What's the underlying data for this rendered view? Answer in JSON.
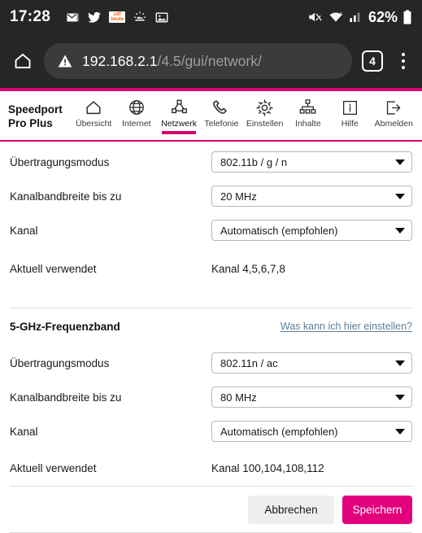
{
  "statusbar": {
    "clock": "17:28",
    "battery_percent": "62%",
    "left_icons": [
      {
        "name": "mail-icon",
        "glyph": "✉"
      },
      {
        "name": "twitter-icon",
        "glyph": "🐦"
      },
      {
        "name": "zdf-heute-icon",
        "line1": "zdf",
        "line2": "heute"
      },
      {
        "name": "weather-icon",
        "glyph": "⛅"
      },
      {
        "name": "gallery-icon",
        "glyph": "🖼"
      }
    ],
    "right_icons": [
      {
        "name": "mute-icon"
      },
      {
        "name": "wifi-icon"
      },
      {
        "name": "signal-icon"
      },
      {
        "name": "battery-icon"
      }
    ]
  },
  "browser": {
    "home_button": "home-icon",
    "warning_icon": "insecure-warning-icon",
    "url_host": "192.168.2.1",
    "url_path": "/4.5/gui/network/",
    "tab_count": "4",
    "menu": "overflow-menu-icon"
  },
  "router": {
    "brand_line1": "Speedport",
    "brand_line2": "Pro Plus",
    "nav": [
      {
        "label": "Übersicht",
        "icon": "home-icon",
        "active": false
      },
      {
        "label": "Internet",
        "icon": "globe-icon",
        "active": false
      },
      {
        "label": "Netzwerk",
        "icon": "network-topology-icon",
        "active": true
      },
      {
        "label": "Telefonie",
        "icon": "phone-icon",
        "active": false
      },
      {
        "label": "Einstellen",
        "icon": "gear-icon",
        "active": false
      },
      {
        "label": "Inhalte",
        "icon": "sitemap-icon",
        "active": false
      },
      {
        "label": "Hilfe",
        "icon": "info-icon",
        "active": false
      },
      {
        "label": "Abmelden",
        "icon": "logout-icon",
        "active": false
      }
    ]
  },
  "band_24": {
    "fields": [
      {
        "label": "Übertragungsmodus",
        "value": "802.11b / g / n"
      },
      {
        "label": "Kanalbandbreite bis zu",
        "value": "20 MHz"
      },
      {
        "label": "Kanal",
        "value": "Automatisch (empfohlen)"
      }
    ],
    "used_label": "Aktuell verwendet",
    "used_value": "Kanal 4,5,6,7,8"
  },
  "band_5": {
    "title": "5-GHz-Frequenzband",
    "help_link": "Was kann ich hier einstellen?",
    "fields": [
      {
        "label": "Übertragungsmodus",
        "value": "802.11n / ac"
      },
      {
        "label": "Kanalbandbreite bis zu",
        "value": "80 MHz"
      },
      {
        "label": "Kanal",
        "value": "Automatisch (empfohlen)"
      }
    ],
    "used_label": "Aktuell verwendet",
    "used_value": "Kanal 100,104,108,112"
  },
  "actions": {
    "cancel": "Abbrechen",
    "save": "Speichern"
  },
  "colors": {
    "magenta": "#e3007d",
    "magenta_border": "#d6006e",
    "link": "#5d7f98",
    "chrome": "#262626"
  }
}
